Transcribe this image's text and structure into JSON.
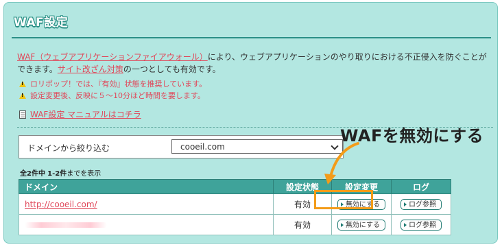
{
  "title": "WAF設定",
  "intro": {
    "link_waf": "WAF（ウェブアプリケーションファイアウォール）",
    "text1": "により、ウェブアプリケーションのやり取りにおける不正侵入を防ぐことができます。",
    "link_site": "サイト改ざん対策",
    "text2": "の一つとしても有効です。"
  },
  "warnings": [
    "ロリポップ！では、『有効』状態を推奨しています。",
    "設定変更後、反映に５～10分ほど時間を要します。"
  ],
  "manual_link": "WAF設定 マニュアルはコチラ",
  "filter": {
    "label": "ドメインから絞り込む",
    "selected": "cooeil.com"
  },
  "count_text": {
    "total": "全2件中",
    "range": "1-2件",
    "suffix": "までを表示"
  },
  "table": {
    "headers": [
      "ドメイン",
      "設定状態",
      "設定変更",
      "ログ"
    ],
    "rows": [
      {
        "domain": "http://cooeil.com/",
        "status": "有効",
        "change_btn": "無効にする",
        "log_btn": "ログ参照"
      },
      {
        "domain": "",
        "status": "有効",
        "change_btn": "無効にする",
        "log_btn": "ログ参照"
      }
    ]
  },
  "annotation": "WAFを無効にする",
  "colors": {
    "panel_bg": "#b3e7e1",
    "header_bg": "#3fa39a",
    "link": "#e0485a",
    "highlight": "#f39c19"
  }
}
